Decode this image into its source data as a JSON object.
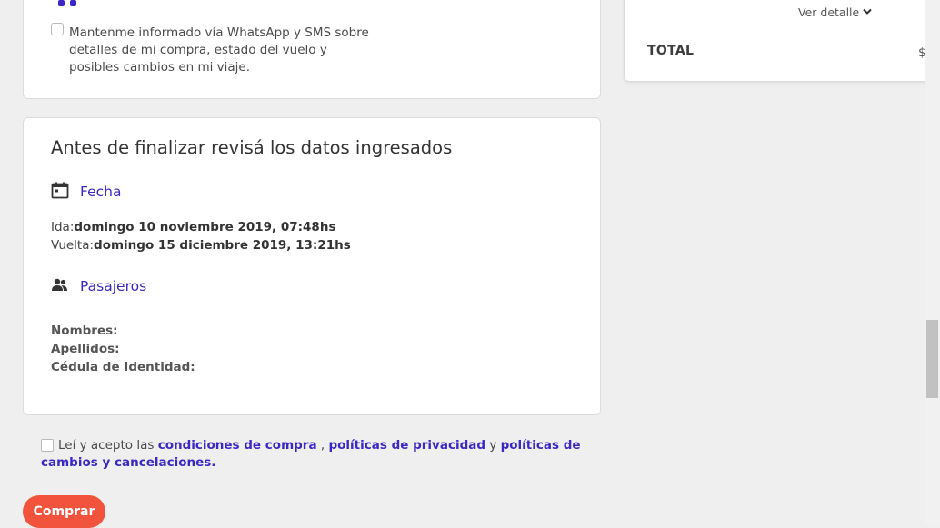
{
  "contact_card": {
    "whatsapp_text": "Mantenme informado vía WhatsApp y SMS sobre detalles de mi compra, estado del vuelo y posibles cambios en mi viaje."
  },
  "review": {
    "title": "Antes de finalizar revisá los datos ingresados",
    "date_section": {
      "title": "Fecha",
      "icon": "calendar-icon",
      "outbound_label": "Ida:",
      "outbound_value": "domingo 10 noviembre 2019, 07:48hs",
      "return_label": "Vuelta:",
      "return_value": "domingo 15 diciembre 2019, 13:21hs"
    },
    "passengers_section": {
      "title": "Pasajeros",
      "icon": "users-icon",
      "names_label": "Nombres:",
      "surnames_label": "Apellidos:",
      "id_label": "Cédula de Identidad:"
    }
  },
  "terms": {
    "prefix": "Leí y acepto las ",
    "link1": "condiciones de compra",
    "sep1": " , ",
    "link2": "políticas de privacidad",
    "sep2": " y ",
    "link3": "políticas de cambios y cancelaciones."
  },
  "buy_button_label": "Comprar",
  "summary": {
    "detail_link": "Ver detalle",
    "total_label": "TOTAL",
    "total_value": "$"
  },
  "colors": {
    "accent_link": "#3b28c4",
    "buy_button": "#f1533c",
    "background": "#efefef"
  }
}
